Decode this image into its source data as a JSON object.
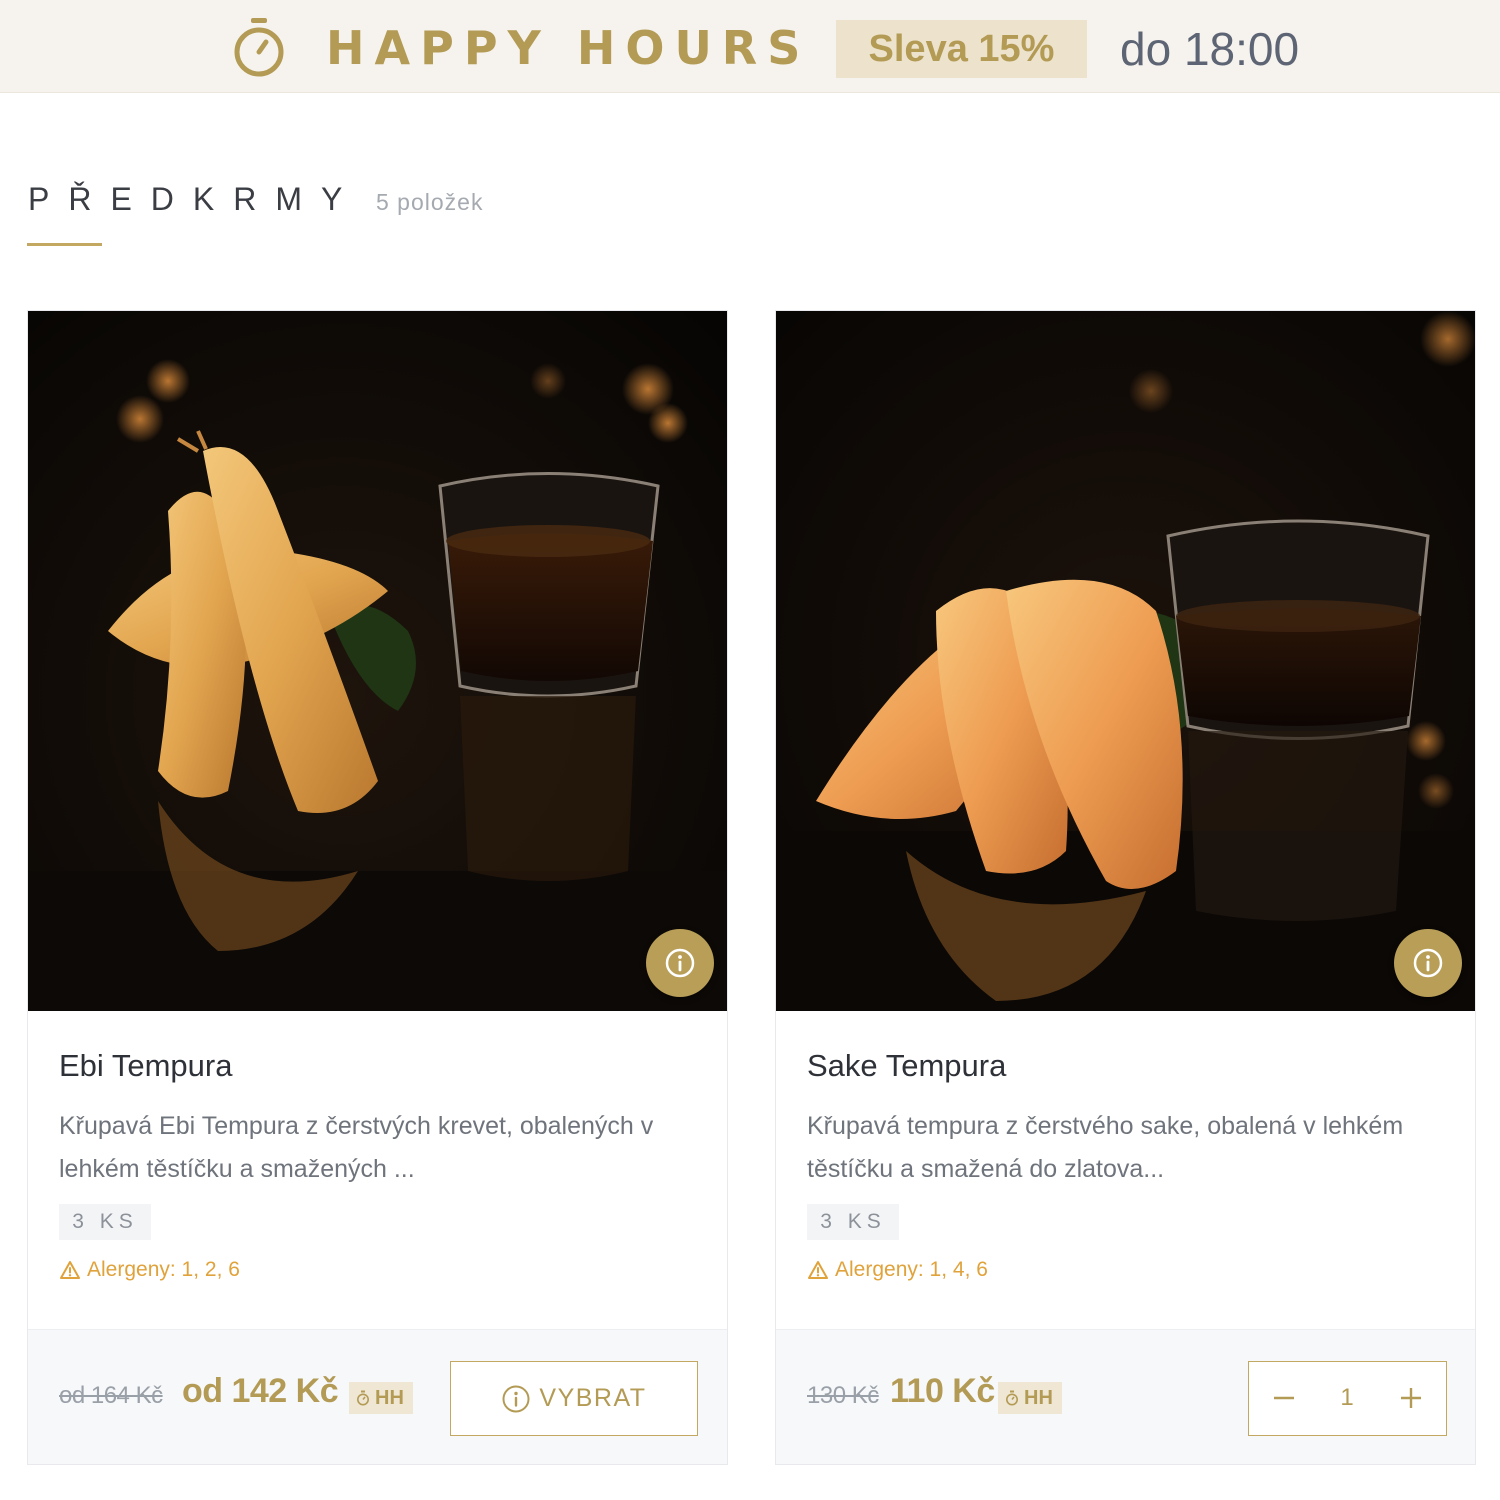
{
  "banner": {
    "title": "HAPPY HOURS",
    "discount": "Sleva 15%",
    "until": "do 18:00"
  },
  "section": {
    "title": "PŘEDKRMY",
    "count": "5 položek"
  },
  "products": [
    {
      "name": "Ebi Tempura",
      "description": "Křupavá Ebi Tempura z čerstvých krevet, obalených v lehkém těstíčku a smažených ...",
      "quantity": "3 KS",
      "allergens": "Alergeny: 1, 2, 6",
      "old_price": "od 164 Kč",
      "new_price": "od 142 Kč",
      "hh_badge": "HH",
      "action_label": "VYBRAT"
    },
    {
      "name": "Sake Tempura",
      "description": "Křupavá tempura z čerstvého sake, obalená v lehkém těstíčku a smažená do zlatova...",
      "quantity": "3 KS",
      "allergens": "Alergeny: 1, 4, 6",
      "old_price": "130 Kč",
      "new_price": "110 Kč",
      "hh_badge": "HH",
      "cart_quantity": "1"
    }
  ],
  "colors": {
    "accent_gold": "#b39b55",
    "allergen_orange": "#e0a23b",
    "banner_bg": "#f6f3ee"
  },
  "icons": [
    "stopwatch-icon",
    "info-icon",
    "warning-icon",
    "minus-icon",
    "plus-icon"
  ]
}
